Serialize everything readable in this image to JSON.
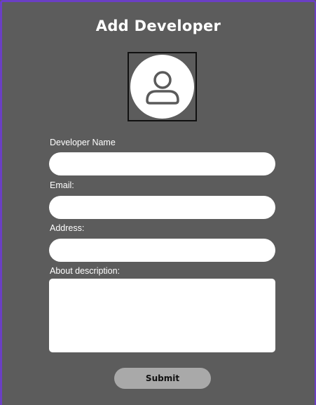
{
  "form": {
    "title": "Add Developer",
    "avatar_icon": "user-icon",
    "fields": {
      "name": {
        "label": "Developer Name",
        "value": "",
        "placeholder": ""
      },
      "email": {
        "label": "Email:",
        "value": "",
        "placeholder": ""
      },
      "address": {
        "label": "Address:",
        "value": "",
        "placeholder": ""
      },
      "about": {
        "label": "About description:",
        "value": "",
        "placeholder": ""
      }
    },
    "submit_label": "Submit"
  },
  "colors": {
    "background": "#5c5c5c",
    "frame_accent": "#6b3fc4",
    "input_background": "#ffffff",
    "button_background": "#a9a9a9"
  }
}
